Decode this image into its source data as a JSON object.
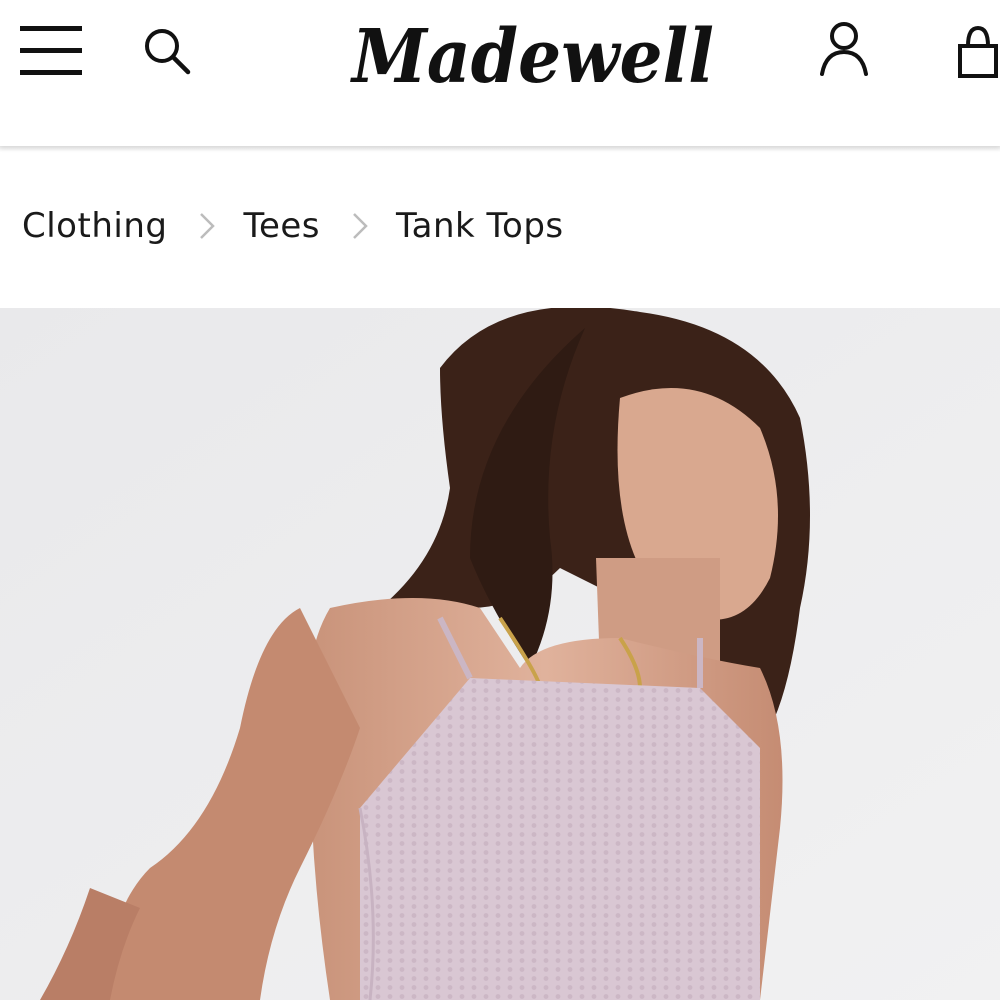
{
  "header": {
    "logo_text": "Madewell",
    "icons": [
      "menu-icon",
      "search-icon",
      "account-icon",
      "shopping-bag-icon"
    ]
  },
  "breadcrumb": {
    "items": [
      "Clothing",
      "Tees",
      "Tank Tops"
    ]
  },
  "colors": {
    "text": "#1a1a1a",
    "hero_background": "#ededef",
    "tank_top": "#d9c6d2",
    "hair": "#3b2218"
  }
}
